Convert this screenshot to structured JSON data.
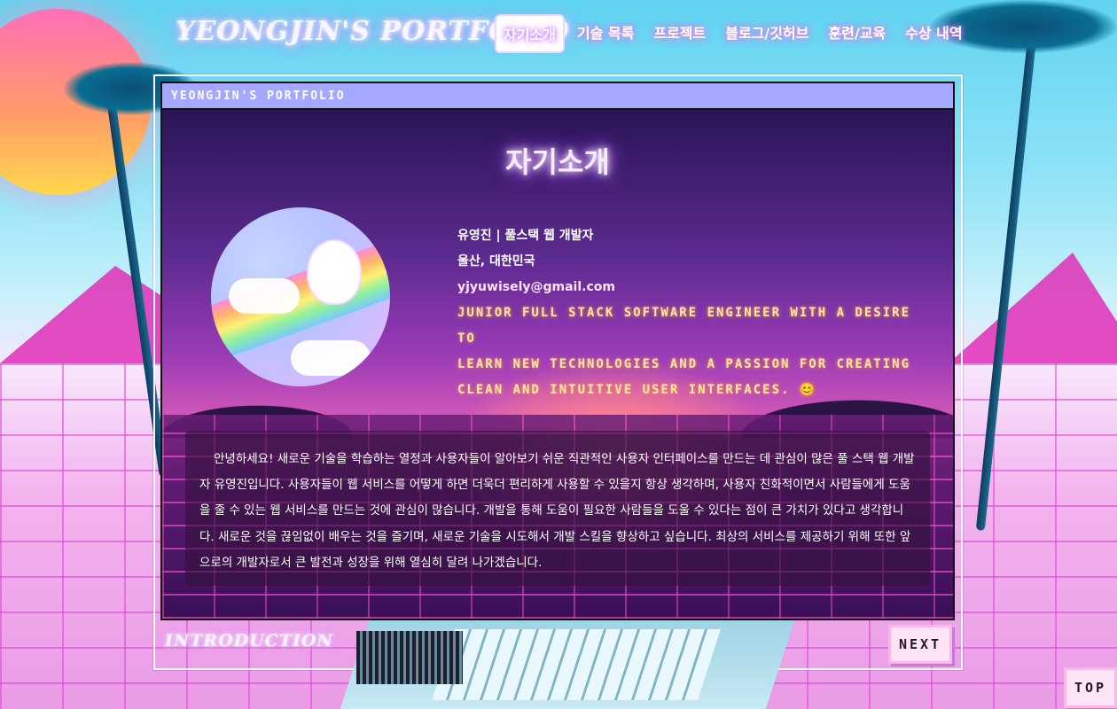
{
  "header": {
    "brand": "YEONGJIN'S PORTFOLIO",
    "nav": [
      {
        "label": "자기소개",
        "active": true
      },
      {
        "label": "기술 목록",
        "active": false
      },
      {
        "label": "프로젝트",
        "active": false
      },
      {
        "label": "블로그/깃허브",
        "active": false
      },
      {
        "label": "훈련/교육",
        "active": false
      },
      {
        "label": "수상 내역",
        "active": false
      }
    ]
  },
  "window": {
    "title": "YEONGJIN'S PORTFOLIO",
    "section_title": "자기소개",
    "profile": {
      "name_role": "유영진 | 풀스택 웹 개발자",
      "location": "울산, 대한민국",
      "email": "yjyuwisely@gmail.com",
      "tagline_lines": [
        "Junior Full Stack Software Engineer with a desire to",
        "learn new technologies and a passion for creating",
        "clean and intuitive user interfaces. 😊"
      ]
    },
    "intro": "안녕하세요! 새로운 기술을 학습하는 열정과 사용자들이 알아보기 쉬운 직관적인 사용자 인터페이스를 만드는 데 관심이 많은 풀 스택 웹 개발자 유영진입니다. 사용자들이 웹 서비스를 어떻게 하면 더욱더 편리하게 사용할 수 있을지 항상 생각하며, 사용자 친화적이면서 사람들에게 도움을 줄 수 있는 웹 서비스를 만드는 것에 관심이 많습니다. 개발을 통해 도움이 필요한 사람들을 도울 수 있다는 점이 큰 가치가 있다고 생각합니다. 새로운 것을 끊임없이 배우는 것을 즐기며, 새로운 기술을 시도해서 개발 스킬을 향상하고 싶습니다. 최상의 서비스를 제공하기 위해 또한 앞으로의 개발자로서 큰 발전과 성장을 위해 열심히 달려 나가겠습니다."
  },
  "footer": {
    "section_label": "INTRODUCTION",
    "next_label": "NEXT",
    "top_label": "TOP"
  },
  "colors": {
    "titlebar": "#a5a8ff",
    "neon_text": "#f6ecff",
    "tagline": "#ffe6a8",
    "button_bg": "#ffe3f6"
  },
  "icons": {
    "avatar": "unicorn-rainbow-illustration"
  }
}
